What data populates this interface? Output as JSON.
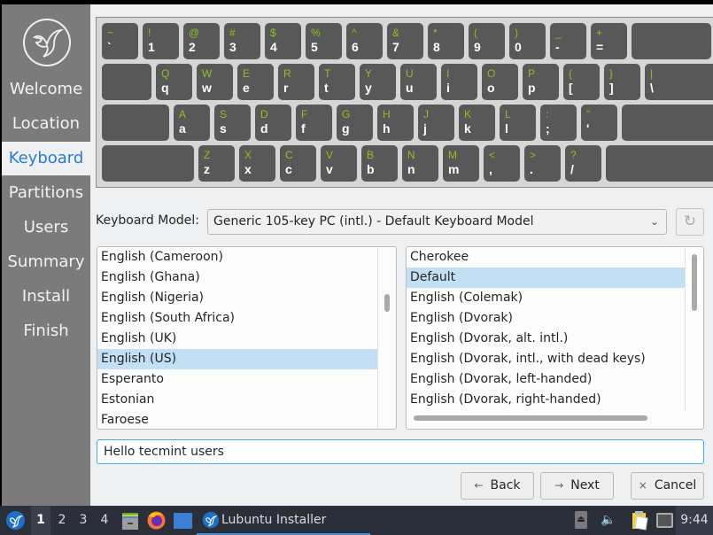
{
  "sidebar": {
    "logo": "lubuntu-bird-logo",
    "items": [
      {
        "label": "Welcome",
        "active": false
      },
      {
        "label": "Location",
        "active": false
      },
      {
        "label": "Keyboard",
        "active": true
      },
      {
        "label": "Partitions",
        "active": false
      },
      {
        "label": "Users",
        "active": false
      },
      {
        "label": "Summary",
        "active": false
      },
      {
        "label": "Install",
        "active": false
      },
      {
        "label": "Finish",
        "active": false
      }
    ]
  },
  "keyboard_preview": {
    "colors": {
      "shift_label": "#8dc11c",
      "base_label": "#ffffff",
      "key": "#585858",
      "frame": "#d6d6d6"
    },
    "rows": [
      [
        [
          "~",
          "`"
        ],
        [
          "!",
          "1"
        ],
        [
          "@",
          "2"
        ],
        [
          "#",
          "3"
        ],
        [
          "$",
          "4"
        ],
        [
          "%",
          "5"
        ],
        [
          "^",
          "6"
        ],
        [
          "&",
          "7"
        ],
        [
          "*",
          "8"
        ],
        [
          "(",
          "9"
        ],
        [
          ")",
          "0"
        ],
        [
          "_",
          "-"
        ],
        [
          "+",
          "="
        ],
        [
          "",
          ""
        ]
      ],
      [
        [
          "",
          ""
        ],
        [
          "Q",
          "q"
        ],
        [
          "W",
          "w"
        ],
        [
          "E",
          "e"
        ],
        [
          "R",
          "r"
        ],
        [
          "T",
          "t"
        ],
        [
          "Y",
          "y"
        ],
        [
          "U",
          "u"
        ],
        [
          "I",
          "i"
        ],
        [
          "O",
          "o"
        ],
        [
          "P",
          "p"
        ],
        [
          "{",
          "["
        ],
        [
          "}",
          "]"
        ],
        [
          "|",
          "\\"
        ]
      ],
      [
        [
          "",
          ""
        ],
        [
          "A",
          "a"
        ],
        [
          "S",
          "s"
        ],
        [
          "D",
          "d"
        ],
        [
          "F",
          "f"
        ],
        [
          "G",
          "g"
        ],
        [
          "H",
          "h"
        ],
        [
          "J",
          "j"
        ],
        [
          "K",
          "k"
        ],
        [
          "L",
          "l"
        ],
        [
          ":",
          ";"
        ],
        [
          "\"",
          "'"
        ],
        [
          "",
          ""
        ]
      ],
      [
        [
          "",
          ""
        ],
        [
          "Z",
          "z"
        ],
        [
          "X",
          "x"
        ],
        [
          "C",
          "c"
        ],
        [
          "V",
          "v"
        ],
        [
          "B",
          "b"
        ],
        [
          "N",
          "n"
        ],
        [
          "M",
          "m"
        ],
        [
          "<",
          ","
        ],
        [
          ">",
          "."
        ],
        [
          "?",
          "/"
        ],
        [
          "",
          ""
        ]
      ]
    ]
  },
  "keyboard_model": {
    "label": "Keyboard Model:",
    "selected": "Generic 105-key PC (intl.)  -  Default Keyboard Model",
    "chevron": "v",
    "reset_icon": "↻"
  },
  "language_list": {
    "items": [
      "English (Cameroon)",
      "English (Ghana)",
      "English (Nigeria)",
      "English (South Africa)",
      "English (UK)",
      "English (US)",
      "Esperanto",
      "Estonian",
      "Faroese"
    ],
    "selected": "English (US)"
  },
  "variant_list": {
    "items": [
      "Cherokee",
      "Default",
      "English (Colemak)",
      "English (Dvorak)",
      "English (Dvorak, alt. intl.)",
      "English (Dvorak, intl., with dead keys)",
      "English (Dvorak, left-handed)",
      "English (Dvorak, right-handed)"
    ],
    "selected": "Default"
  },
  "test_input": {
    "value": "Hello tecmint users"
  },
  "buttons": {
    "back": {
      "label": "Back",
      "icon": "←"
    },
    "next": {
      "label": "Next",
      "icon": "→"
    },
    "cancel": {
      "label": "Cancel",
      "icon": "×"
    }
  },
  "taskbar": {
    "workspaces": [
      "1",
      "2",
      "3",
      "4"
    ],
    "active_workspace": "1",
    "task_label": "Lubuntu Installer",
    "clock": "9:44"
  }
}
